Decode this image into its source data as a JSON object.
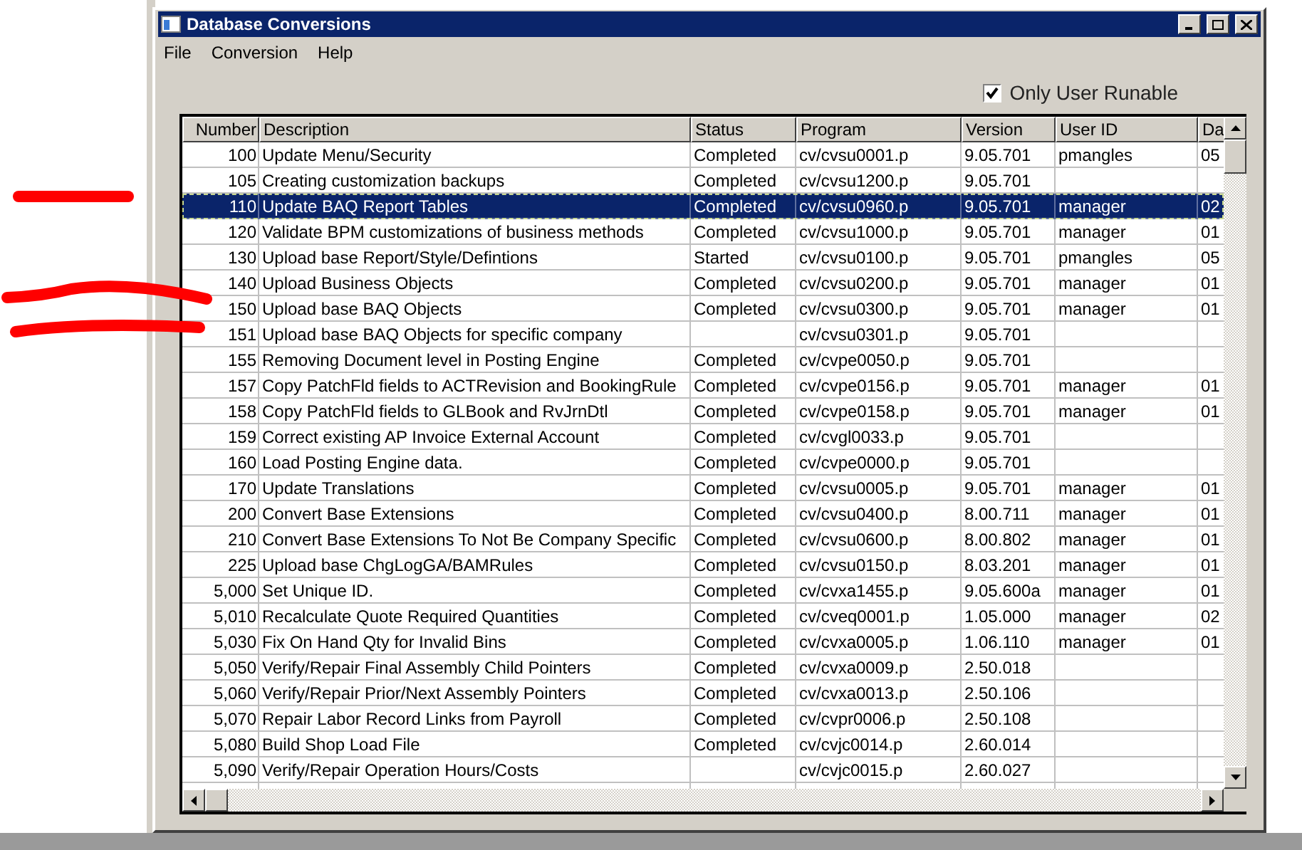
{
  "window": {
    "title": "Database Conversions"
  },
  "menu": [
    "File",
    "Conversion",
    "Help"
  ],
  "only_user_runable": {
    "label": "Only User Runable",
    "checked": true
  },
  "table": {
    "columns": [
      "Number",
      "Description",
      "Status",
      "Program",
      "Version",
      "User ID",
      "Da"
    ],
    "rows": [
      {
        "number": "100",
        "description": "Update Menu/Security",
        "status": "Completed",
        "program": "cv/cvsu0001.p",
        "version": "9.05.701",
        "user_id": "pmangles",
        "column_7": "05",
        "selected": false
      },
      {
        "number": "105",
        "description": "Creating customization backups",
        "status": "Completed",
        "program": "cv/cvsu1200.p",
        "version": "9.05.701",
        "selected": false
      },
      {
        "number": "110",
        "description": "Update BAQ Report Tables",
        "status": "Completed",
        "program": "cv/cvsu0960.p",
        "version": "9.05.701",
        "user_id": "manager",
        "column_7": "02",
        "selected": true
      },
      {
        "number": "120",
        "description": "Validate BPM customizations of business methods",
        "status": "Completed",
        "program": "cv/cvsu1000.p",
        "version": "9.05.701",
        "user_id": "manager",
        "column_7": "01",
        "selected": false
      },
      {
        "number": "130",
        "description": "Upload base Report/Style/Defintions",
        "status": "Started",
        "program": "cv/cvsu0100.p",
        "version": "9.05.701",
        "user_id": "pmangles",
        "column_7": "05",
        "selected": false
      },
      {
        "number": "140",
        "description": "Upload Business Objects",
        "status": "Completed",
        "program": "cv/cvsu0200.p",
        "version": "9.05.701",
        "user_id": "manager",
        "column_7": "01",
        "selected": false
      },
      {
        "number": "150",
        "description": "Upload base BAQ Objects",
        "status": "Completed",
        "program": "cv/cvsu0300.p",
        "version": "9.05.701",
        "user_id": "manager",
        "column_7": "01",
        "selected": false
      },
      {
        "number": "151",
        "description": "Upload base BAQ Objects for specific company",
        "program": "cv/cvsu0301.p",
        "version": "9.05.701",
        "selected": false
      },
      {
        "number": "155",
        "description": "Removing Document level in Posting Engine",
        "status": "Completed",
        "program": "cv/cvpe0050.p",
        "version": "9.05.701",
        "selected": false
      },
      {
        "number": "157",
        "description": "Copy PatchFld fields to ACTRevision and BookingRule",
        "status": "Completed",
        "program": "cv/cvpe0156.p",
        "version": "9.05.701",
        "user_id": "manager",
        "column_7": "01",
        "selected": false
      },
      {
        "number": "158",
        "description": "Copy PatchFld fields to GLBook and RvJrnDtl",
        "status": "Completed",
        "program": "cv/cvpe0158.p",
        "version": "9.05.701",
        "user_id": "manager",
        "column_7": "01",
        "selected": false
      },
      {
        "number": "159",
        "description": "Correct existing AP Invoice External Account",
        "status": "Completed",
        "program": "cv/cvgl0033.p",
        "version": "9.05.701",
        "selected": false
      },
      {
        "number": "160",
        "description": "Load Posting Engine data.",
        "status": "Completed",
        "program": "cv/cvpe0000.p",
        "version": "9.05.701",
        "selected": false
      },
      {
        "number": "170",
        "description": "Update Translations",
        "status": "Completed",
        "program": "cv/cvsu0005.p",
        "version": "9.05.701",
        "user_id": "manager",
        "column_7": "01",
        "selected": false
      },
      {
        "number": "200",
        "description": "Convert Base Extensions",
        "status": "Completed",
        "program": "cv/cvsu0400.p",
        "version": "8.00.711",
        "user_id": "manager",
        "column_7": "01",
        "selected": false
      },
      {
        "number": "210",
        "description": "Convert Base Extensions To Not Be Company Specific",
        "status": "Completed",
        "program": "cv/cvsu0600.p",
        "version": "8.00.802",
        "user_id": "manager",
        "column_7": "01",
        "selected": false
      },
      {
        "number": "225",
        "description": "Upload base ChgLogGA/BAMRules",
        "status": "Completed",
        "program": "cv/cvsu0150.p",
        "version": "8.03.201",
        "user_id": "manager",
        "column_7": "01",
        "selected": false
      },
      {
        "number": "5,000",
        "description": "Set Unique ID.",
        "status": "Completed",
        "program": "cv/cvxa1455.p",
        "version": "9.05.600a",
        "user_id": "manager",
        "column_7": "01",
        "selected": false
      },
      {
        "number": "5,010",
        "description": "Recalculate Quote Required Quantities",
        "status": "Completed",
        "program": "cv/cveq0001.p",
        "version": "1.05.000",
        "user_id": "manager",
        "column_7": "02",
        "selected": false
      },
      {
        "number": "5,030",
        "description": "Fix On Hand Qty for Invalid Bins",
        "status": "Completed",
        "program": "cv/cvxa0005.p",
        "version": "1.06.110",
        "user_id": "manager",
        "column_7": "01",
        "selected": false
      },
      {
        "number": "5,050",
        "description": "Verify/Repair Final Assembly Child Pointers",
        "status": "Completed",
        "program": "cv/cvxa0009.p",
        "version": "2.50.018",
        "selected": false
      },
      {
        "number": "5,060",
        "description": "Verify/Repair Prior/Next Assembly Pointers",
        "status": "Completed",
        "program": "cv/cvxa0013.p",
        "version": "2.50.106",
        "selected": false
      },
      {
        "number": "5,070",
        "description": "Repair Labor Record Links from Payroll",
        "status": "Completed",
        "program": "cv/cvpr0006.p",
        "version": "2.50.108",
        "selected": false
      },
      {
        "number": "5,080",
        "description": "Build Shop Load File",
        "status": "Completed",
        "program": "cv/cvjc0014.p",
        "version": "2.60.014",
        "selected": false
      },
      {
        "number": "5,090",
        "description": "Verify/Repair Operation Hours/Costs",
        "program": "cv/cvjc0015.p",
        "version": "2.60.027",
        "selected": false
      }
    ]
  }
}
